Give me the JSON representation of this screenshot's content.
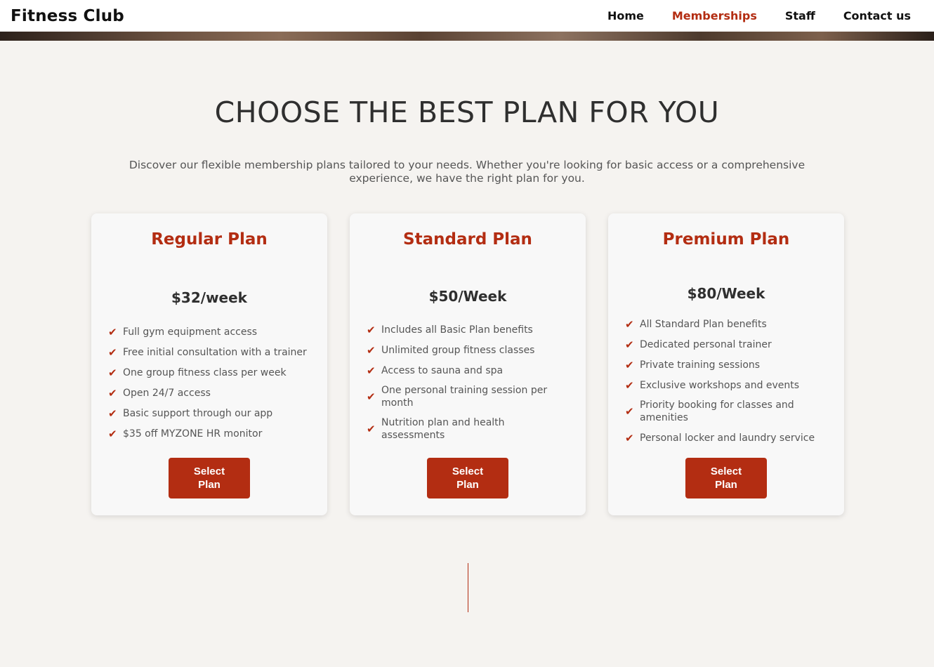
{
  "nav": {
    "brand": "Fitness Club",
    "links": [
      {
        "label": "Home",
        "active": false
      },
      {
        "label": "Memberships",
        "active": true
      },
      {
        "label": "Staff",
        "active": false
      },
      {
        "label": "Contact us",
        "active": false
      }
    ]
  },
  "section": {
    "title": "CHOOSE THE BEST PLAN FOR YOU",
    "intro": "Discover our flexible membership plans tailored to your needs. Whether you're looking for basic access or a comprehensive experience, we have the right plan for you."
  },
  "plans": [
    {
      "name": "Regular Plan",
      "price": "$32/week",
      "features": [
        "Full gym equipment access",
        "Free initial consultation with a trainer",
        "One group fitness class per week",
        "Open 24/7 access",
        "Basic support through our app",
        "$35 off MYZONE HR monitor"
      ],
      "button": "Select Plan"
    },
    {
      "name": "Standard Plan",
      "price": "$50/Week",
      "features": [
        "Includes all Basic Plan benefits",
        "Unlimited group fitness classes",
        "Access to sauna and spa",
        "One personal training session per month",
        "Nutrition plan and health assessments"
      ],
      "button": "Select Plan"
    },
    {
      "name": "Premium Plan",
      "price": "$80/Week",
      "features": [
        "All Standard Plan benefits",
        "Dedicated personal trainer",
        "Private training sessions",
        "Exclusive workshops and events",
        "Priority booking for classes and amenities",
        "Personal locker and laundry service"
      ],
      "button": "Select Plan"
    }
  ],
  "icons": {
    "check": "check-icon"
  },
  "colors": {
    "accent": "#b32d12",
    "background": "#f5f3f0",
    "card": "#f8f8f8"
  }
}
